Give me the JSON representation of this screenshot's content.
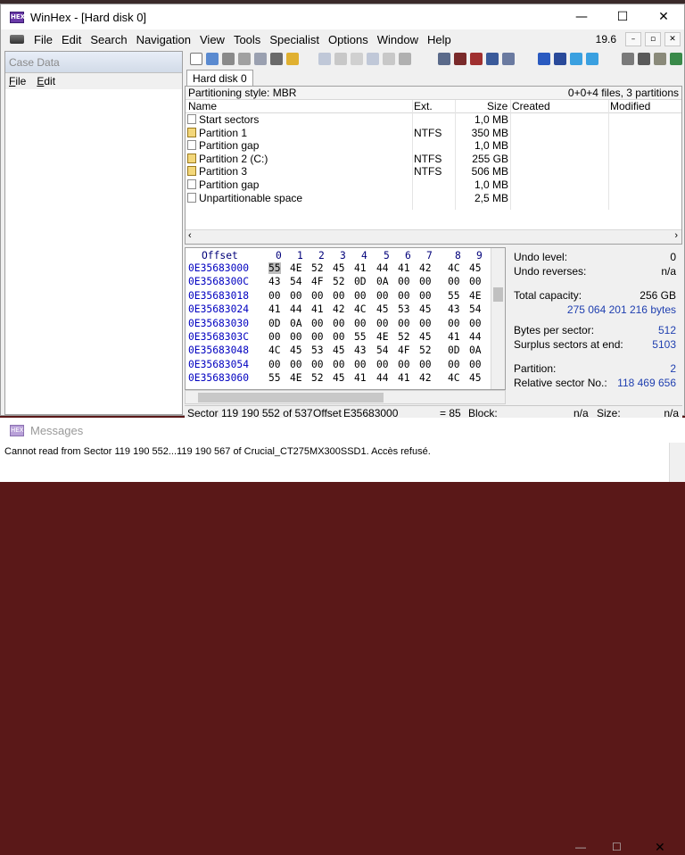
{
  "window": {
    "title": "WinHex - [Hard disk 0]",
    "icon_text": "HEX",
    "controls": [
      "—",
      "☐",
      "✕"
    ]
  },
  "menu": [
    "File",
    "Edit",
    "Search",
    "Navigation",
    "View",
    "Tools",
    "Specialist",
    "Options",
    "Window",
    "Help"
  ],
  "zoom_label": "19.6",
  "mdi_controls": [
    "–",
    "▫",
    "✕"
  ],
  "case_panel": {
    "title": "Case Data",
    "menu": [
      {
        "label": "ile",
        "accel": "F"
      },
      {
        "label": "dit",
        "accel": "E"
      }
    ]
  },
  "tab_label": "Hard disk 0",
  "filelist": {
    "partition_style": "Partitioning style: MBR",
    "summary": "0+0+4 files, 3 partitions",
    "columns": {
      "name": "Name",
      "ext": "Ext.",
      "size": "Size",
      "created": "Created",
      "modified": "Modified"
    },
    "rows": [
      {
        "name": "Start sectors",
        "ext": "",
        "size": "1,0 MB",
        "icon": "file-icon"
      },
      {
        "name": "Partition 1",
        "ext": "NTFS",
        "size": "350 MB",
        "icon": "partition-icon"
      },
      {
        "name": "Partition gap",
        "ext": "",
        "size": "1,0 MB",
        "icon": "file-icon"
      },
      {
        "name": "Partition 2 (C:)",
        "ext": "NTFS",
        "size": "255 GB",
        "icon": "partition-icon"
      },
      {
        "name": "Partition 3",
        "ext": "NTFS",
        "size": "506 MB",
        "icon": "partition-icon"
      },
      {
        "name": "Partition gap",
        "ext": "",
        "size": "1,0 MB",
        "icon": "file-icon"
      },
      {
        "name": "Unpartitionable space",
        "ext": "",
        "size": "2,5 MB",
        "icon": "file-icon"
      }
    ]
  },
  "hex": {
    "offset_label": "Offset",
    "columns": [
      "0",
      "1",
      "2",
      "3",
      "4",
      "5",
      "6",
      "7",
      "8",
      "9"
    ],
    "rows": [
      {
        "offset": "0E35683000",
        "bytes": [
          "55",
          "4E",
          "52",
          "45",
          "41",
          "44",
          "41",
          "42",
          "4C",
          "45"
        ]
      },
      {
        "offset": "0E3568300C",
        "bytes": [
          "43",
          "54",
          "4F",
          "52",
          "0D",
          "0A",
          "00",
          "00",
          "00",
          "00"
        ]
      },
      {
        "offset": "0E35683018",
        "bytes": [
          "00",
          "00",
          "00",
          "00",
          "00",
          "00",
          "00",
          "00",
          "55",
          "4E"
        ]
      },
      {
        "offset": "0E35683024",
        "bytes": [
          "41",
          "44",
          "41",
          "42",
          "4C",
          "45",
          "53",
          "45",
          "43",
          "54"
        ]
      },
      {
        "offset": "0E35683030",
        "bytes": [
          "0D",
          "0A",
          "00",
          "00",
          "00",
          "00",
          "00",
          "00",
          "00",
          "00"
        ]
      },
      {
        "offset": "0E3568303C",
        "bytes": [
          "00",
          "00",
          "00",
          "00",
          "55",
          "4E",
          "52",
          "45",
          "41",
          "44"
        ]
      },
      {
        "offset": "0E35683048",
        "bytes": [
          "4C",
          "45",
          "53",
          "45",
          "43",
          "54",
          "4F",
          "52",
          "0D",
          "0A"
        ]
      },
      {
        "offset": "0E35683054",
        "bytes": [
          "00",
          "00",
          "00",
          "00",
          "00",
          "00",
          "00",
          "00",
          "00",
          "00"
        ]
      },
      {
        "offset": "0E35683060",
        "bytes": [
          "55",
          "4E",
          "52",
          "45",
          "41",
          "44",
          "41",
          "42",
          "4C",
          "45"
        ]
      }
    ]
  },
  "info": {
    "undo_level_label": "Undo level:",
    "undo_level": "0",
    "undo_reverses_label": "Undo reverses:",
    "undo_reverses": "n/a",
    "total_capacity_label": "Total capacity:",
    "total_capacity_gb": "256 GB",
    "total_capacity_bytes": "275 064 201 216 bytes",
    "bytes_per_sector_label": "Bytes per sector:",
    "bytes_per_sector": "512",
    "surplus_label": "Surplus sectors at end:",
    "surplus": "5103",
    "partition_label": "Partition:",
    "partition": "2",
    "relative_sector_label": "Relative sector No.:",
    "relative_sector": "118 469 656"
  },
  "status": {
    "sector": "Sector 119 190 552 of 537",
    "offset_label": "Offset",
    "offset": "E35683000",
    "value": "= 85",
    "block_label": "Block:",
    "block": "n/a",
    "size_label": "Size:",
    "size": "n/a"
  },
  "messages": {
    "title": "Messages",
    "icon_text": "HEX",
    "text": "Cannot read from Sector 119 190 552...119 190 567 of Crucial_CT275MX300SSD1. Accès refusé.",
    "controls": [
      "—",
      "☐",
      "✕"
    ]
  },
  "colors": {
    "offset_blue": "#0000c0",
    "info_blue": "#2040b0",
    "selection": "#bcbcbc"
  }
}
